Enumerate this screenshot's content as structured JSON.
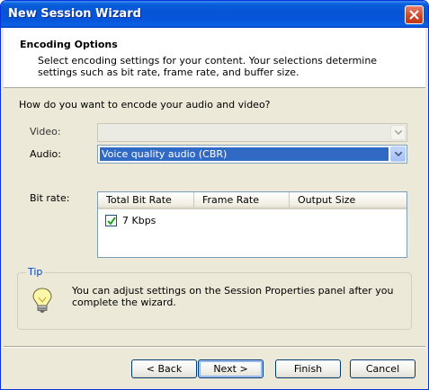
{
  "window": {
    "title": "New Session Wizard"
  },
  "header": {
    "title": "Encoding Options",
    "description": "Select encoding settings for your content. Your selections determine settings such as bit rate, frame rate, and buffer size."
  },
  "question": "How do you want to encode your audio and video?",
  "video": {
    "label": "Video:",
    "value": ""
  },
  "audio": {
    "label": "Audio:",
    "value": "Voice quality audio (CBR)"
  },
  "bitrate": {
    "label": "Bit rate:",
    "columns": [
      "Total Bit Rate",
      "Frame Rate",
      "Output Size"
    ],
    "rows": [
      {
        "checked": true,
        "total_bit_rate": "7 Kbps"
      }
    ]
  },
  "tip": {
    "label": "Tip",
    "icon": "lightbulb-icon",
    "text": "You can adjust settings on the Session Properties panel after you complete the wizard."
  },
  "buttons": {
    "back": "< Back",
    "next": "Next >",
    "finish": "Finish",
    "cancel": "Cancel"
  },
  "colors": {
    "titlebar": "#0654d6",
    "selection": "#316ac5",
    "dialog": "#ece9d8"
  }
}
